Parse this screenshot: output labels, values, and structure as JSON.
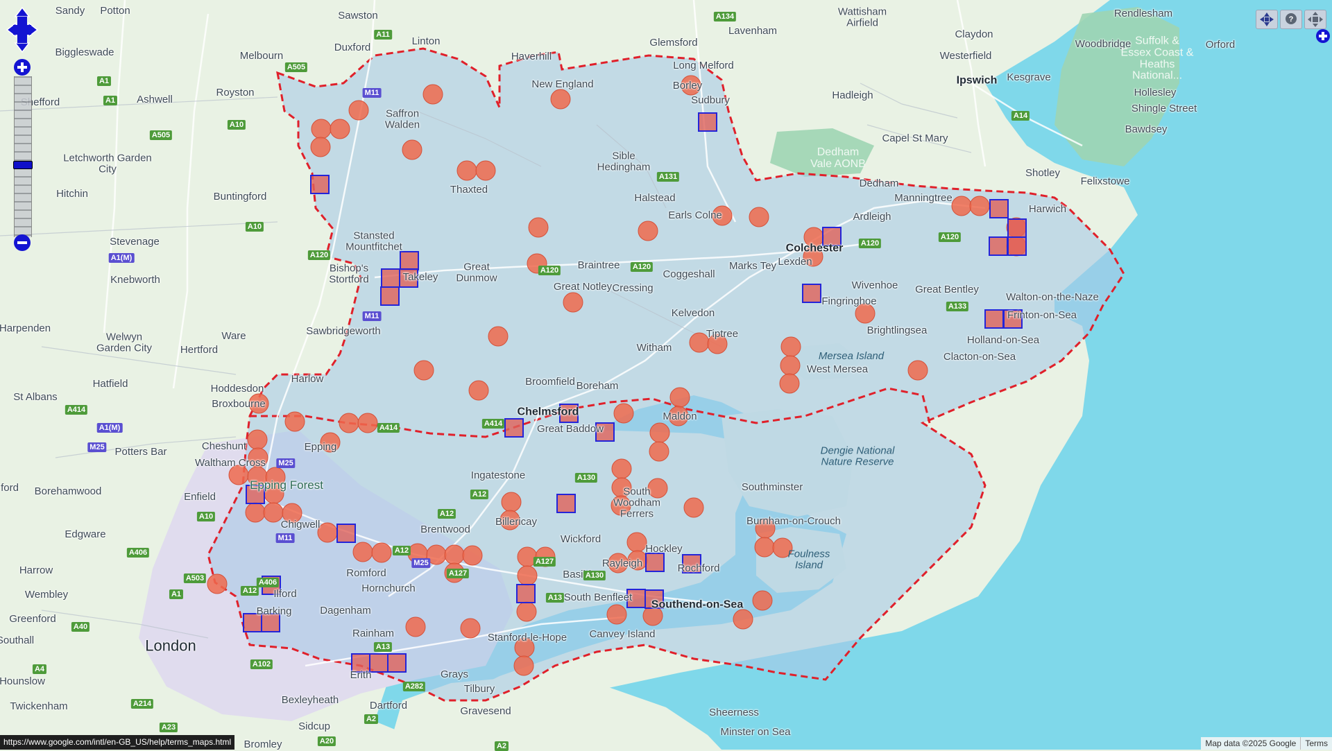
{
  "place_labels": [
    {
      "text": "Sandy",
      "cls": ""
    },
    {
      "text": "Potton",
      "cls": ""
    },
    {
      "text": "Sawston",
      "cls": ""
    },
    {
      "text": "Wattisham Airfield",
      "cls": ""
    },
    {
      "text": "Rendlesham",
      "cls": ""
    },
    {
      "text": "Duxford",
      "cls": ""
    },
    {
      "text": "Linton",
      "cls": ""
    },
    {
      "text": "Glemsford",
      "cls": ""
    },
    {
      "text": "Lavenham",
      "cls": ""
    },
    {
      "text": "Claydon",
      "cls": ""
    },
    {
      "text": "Woodbridge",
      "cls": ""
    },
    {
      "text": "Biggleswade",
      "cls": ""
    },
    {
      "text": "Melbourn",
      "cls": ""
    },
    {
      "text": "Haverhill",
      "cls": ""
    },
    {
      "text": "Long Melford",
      "cls": ""
    },
    {
      "text": "Westerfield",
      "cls": ""
    },
    {
      "text": "Orford",
      "cls": ""
    },
    {
      "text": "New England",
      "cls": ""
    },
    {
      "text": "Ipswich",
      "cls": "big"
    },
    {
      "text": "Kesgrave",
      "cls": ""
    },
    {
      "text": "Royston",
      "cls": ""
    },
    {
      "text": "Ashwell",
      "cls": ""
    },
    {
      "text": "Borley",
      "cls": ""
    },
    {
      "text": "Hadleigh",
      "cls": ""
    },
    {
      "text": "Hollesley",
      "cls": ""
    },
    {
      "text": "Shefford",
      "cls": ""
    },
    {
      "text": "Saffron Walden",
      "cls": ""
    },
    {
      "text": "Sudbury",
      "cls": ""
    },
    {
      "text": "Shingle Street",
      "cls": ""
    },
    {
      "text": "Bawdsey",
      "cls": ""
    },
    {
      "text": "Capel St Mary",
      "cls": ""
    },
    {
      "text": "Letchworth Garden City",
      "cls": ""
    },
    {
      "text": "Sible Hedingham",
      "cls": ""
    },
    {
      "text": "Hitchin",
      "cls": ""
    },
    {
      "text": "Dedham",
      "cls": ""
    },
    {
      "text": "Shotley",
      "cls": ""
    },
    {
      "text": "Felixstowe",
      "cls": ""
    },
    {
      "text": "Thaxted",
      "cls": ""
    },
    {
      "text": "Buntingford",
      "cls": ""
    },
    {
      "text": "Halstead",
      "cls": ""
    },
    {
      "text": "Manningtree",
      "cls": ""
    },
    {
      "text": "Harwich",
      "cls": ""
    },
    {
      "text": "Earls Colne",
      "cls": ""
    },
    {
      "text": "Ardleigh",
      "cls": ""
    },
    {
      "text": "Stevenage",
      "cls": ""
    },
    {
      "text": "Stansted Mountfitchet",
      "cls": ""
    },
    {
      "text": "Colchester",
      "cls": "big"
    },
    {
      "text": "Knebworth",
      "cls": ""
    },
    {
      "text": "Bishop's Stortford",
      "cls": ""
    },
    {
      "text": "Takeley",
      "cls": ""
    },
    {
      "text": "Great Dunmow",
      "cls": ""
    },
    {
      "text": "Braintree",
      "cls": ""
    },
    {
      "text": "Coggeshall",
      "cls": ""
    },
    {
      "text": "Marks Tey",
      "cls": ""
    },
    {
      "text": "Lexden",
      "cls": ""
    },
    {
      "text": "Wivenhoe",
      "cls": ""
    },
    {
      "text": "Great Bentley",
      "cls": ""
    },
    {
      "text": "Great Notley",
      "cls": ""
    },
    {
      "text": "Cressing",
      "cls": ""
    },
    {
      "text": "Fingringhoe",
      "cls": ""
    },
    {
      "text": "Walton-on-the-Naze",
      "cls": ""
    },
    {
      "text": "Harpenden",
      "cls": ""
    },
    {
      "text": "Welwyn Garden City",
      "cls": ""
    },
    {
      "text": "Sawbridgeworth",
      "cls": ""
    },
    {
      "text": "Kelvedon",
      "cls": ""
    },
    {
      "text": "Brightlingsea",
      "cls": ""
    },
    {
      "text": "Frinton-on-Sea",
      "cls": ""
    },
    {
      "text": "Tiptree",
      "cls": ""
    },
    {
      "text": "Hertford",
      "cls": ""
    },
    {
      "text": "Ware",
      "cls": ""
    },
    {
      "text": "Witham",
      "cls": ""
    },
    {
      "text": "Holland-on-Sea",
      "cls": ""
    },
    {
      "text": "Clacton-on-Sea",
      "cls": ""
    },
    {
      "text": "West Mersea",
      "cls": ""
    },
    {
      "text": "Harlow",
      "cls": ""
    },
    {
      "text": "Hatfield",
      "cls": ""
    },
    {
      "text": "Broomfield",
      "cls": ""
    },
    {
      "text": "Boreham",
      "cls": ""
    },
    {
      "text": "Hoddesdon",
      "cls": ""
    },
    {
      "text": "St Albans",
      "cls": ""
    },
    {
      "text": "Broxbourne",
      "cls": ""
    },
    {
      "text": "Chelmsford",
      "cls": "big"
    },
    {
      "text": "Maldon",
      "cls": ""
    },
    {
      "text": "Great Baddow",
      "cls": ""
    },
    {
      "text": "Epping",
      "cls": ""
    },
    {
      "text": "Cheshunt",
      "cls": ""
    },
    {
      "text": "Potters Bar",
      "cls": ""
    },
    {
      "text": "Waltham Cross",
      "cls": ""
    },
    {
      "text": "Ingatestone",
      "cls": ""
    },
    {
      "text": "Southminster",
      "cls": ""
    },
    {
      "text": "Borehamwood",
      "cls": ""
    },
    {
      "text": "Enfield",
      "cls": ""
    },
    {
      "text": "South Woodham Ferrers",
      "cls": ""
    },
    {
      "text": "Chigwell",
      "cls": ""
    },
    {
      "text": "Billericay",
      "cls": ""
    },
    {
      "text": "Burnham-on-Crouch",
      "cls": ""
    },
    {
      "text": "Brentwood",
      "cls": ""
    },
    {
      "text": "Edgware",
      "cls": ""
    },
    {
      "text": "Wickford",
      "cls": ""
    },
    {
      "text": "Hockley",
      "cls": ""
    },
    {
      "text": "Rayleigh",
      "cls": ""
    },
    {
      "text": "Rochford",
      "cls": ""
    },
    {
      "text": "Harrow",
      "cls": ""
    },
    {
      "text": "Romford",
      "cls": ""
    },
    {
      "text": "Basildon",
      "cls": ""
    },
    {
      "text": "Hornchurch",
      "cls": ""
    },
    {
      "text": "Wembley",
      "cls": ""
    },
    {
      "text": "Ilford",
      "cls": ""
    },
    {
      "text": "South Benfleet",
      "cls": ""
    },
    {
      "text": "Southend-on-Sea",
      "cls": "big"
    },
    {
      "text": "Greenford",
      "cls": ""
    },
    {
      "text": "Dagenham",
      "cls": ""
    },
    {
      "text": "Barking",
      "cls": ""
    },
    {
      "text": "Canvey Island",
      "cls": ""
    },
    {
      "text": "Rainham",
      "cls": ""
    },
    {
      "text": "Stanford-le-Hope",
      "cls": ""
    },
    {
      "text": "London",
      "cls": "huge"
    },
    {
      "text": "Southall",
      "cls": ""
    },
    {
      "text": "Hounslow",
      "cls": ""
    },
    {
      "text": "Grays",
      "cls": ""
    },
    {
      "text": "Erith",
      "cls": ""
    },
    {
      "text": "Tilbury",
      "cls": ""
    },
    {
      "text": "Twickenham",
      "cls": ""
    },
    {
      "text": "Bexleyheath",
      "cls": ""
    },
    {
      "text": "Dartford",
      "cls": ""
    },
    {
      "text": "Gravesend",
      "cls": ""
    },
    {
      "text": "Sheerness",
      "cls": ""
    },
    {
      "text": "Sidcup",
      "cls": ""
    },
    {
      "text": "Minster on Sea",
      "cls": ""
    },
    {
      "text": "Bromley",
      "cls": ""
    },
    {
      "text": "ford",
      "cls": ""
    },
    {
      "text": "Dedham Vale AONB",
      "cls": "parkw"
    },
    {
      "text": "Suffolk & Essex Coast & Heaths National...",
      "cls": "parkw"
    },
    {
      "text": "Mersea Island",
      "cls": "water"
    },
    {
      "text": "Dengie National Nature Reserve",
      "cls": "water"
    },
    {
      "text": "Foulness Island",
      "cls": "water"
    },
    {
      "text": "Epping Forest",
      "cls": "forest"
    }
  ],
  "road_shields": [
    {
      "text": "A11",
      "t": "a"
    },
    {
      "text": "A134",
      "t": "a"
    },
    {
      "text": "A505",
      "t": "a"
    },
    {
      "text": "M11",
      "t": "m"
    },
    {
      "text": "A1",
      "t": "a"
    },
    {
      "text": "A1",
      "t": "a"
    },
    {
      "text": "A10",
      "t": "a"
    },
    {
      "text": "A505",
      "t": "a"
    },
    {
      "text": "A14",
      "t": "a"
    },
    {
      "text": "A131",
      "t": "a"
    },
    {
      "text": "A10",
      "t": "a"
    },
    {
      "text": "A120",
      "t": "a"
    },
    {
      "text": "A120",
      "t": "a"
    },
    {
      "text": "A1(M)",
      "t": "m"
    },
    {
      "text": "A120",
      "t": "a"
    },
    {
      "text": "A120",
      "t": "a"
    },
    {
      "text": "A120",
      "t": "a"
    },
    {
      "text": "M11",
      "t": "m"
    },
    {
      "text": "A133",
      "t": "a"
    },
    {
      "text": "A414",
      "t": "a"
    },
    {
      "text": "A1(M)",
      "t": "m"
    },
    {
      "text": "A414",
      "t": "a"
    },
    {
      "text": "A414",
      "t": "a"
    },
    {
      "text": "M25",
      "t": "m"
    },
    {
      "text": "M25",
      "t": "m"
    },
    {
      "text": "A130",
      "t": "a"
    },
    {
      "text": "A12",
      "t": "a"
    },
    {
      "text": "A10",
      "t": "a"
    },
    {
      "text": "A12",
      "t": "a"
    },
    {
      "text": "M11",
      "t": "m"
    },
    {
      "text": "A406",
      "t": "a"
    },
    {
      "text": "A12",
      "t": "a"
    },
    {
      "text": "M25",
      "t": "m"
    },
    {
      "text": "A127",
      "t": "a"
    },
    {
      "text": "A127",
      "t": "a"
    },
    {
      "text": "A503",
      "t": "a"
    },
    {
      "text": "A406",
      "t": "a"
    },
    {
      "text": "A12",
      "t": "a"
    },
    {
      "text": "A130",
      "t": "a"
    },
    {
      "text": "A13",
      "t": "a"
    },
    {
      "text": "A1",
      "t": "a"
    },
    {
      "text": "A40",
      "t": "a"
    },
    {
      "text": "A13",
      "t": "a"
    },
    {
      "text": "A102",
      "t": "a"
    },
    {
      "text": "A4",
      "t": "a"
    },
    {
      "text": "A282",
      "t": "a"
    },
    {
      "text": "A214",
      "t": "a"
    },
    {
      "text": "A2",
      "t": "a"
    },
    {
      "text": "A23",
      "t": "a"
    },
    {
      "text": "A20",
      "t": "a"
    },
    {
      "text": "A2",
      "t": "a"
    }
  ],
  "status_url": "https://www.google.com/intl/en-GB_US/help/terms_maps.html",
  "attribution": {
    "map_data": "Map data ©2025 Google",
    "terms": "Terms"
  },
  "colors": {
    "land": "#e9f2e4",
    "sea": "#7fd8ea",
    "region_fill": "#a9c9e6",
    "region_border": "#e0202a",
    "marker_fill": "#ef6a4e",
    "square_border": "#2424d8",
    "park": "#9fd5b2",
    "urban": "#e0dcee"
  },
  "icons": [
    "pan-icon",
    "zoom-in-icon",
    "zoom-out-icon",
    "navigation-icon",
    "help-icon",
    "fullscreen-icon",
    "layer-switcher-icon"
  ]
}
